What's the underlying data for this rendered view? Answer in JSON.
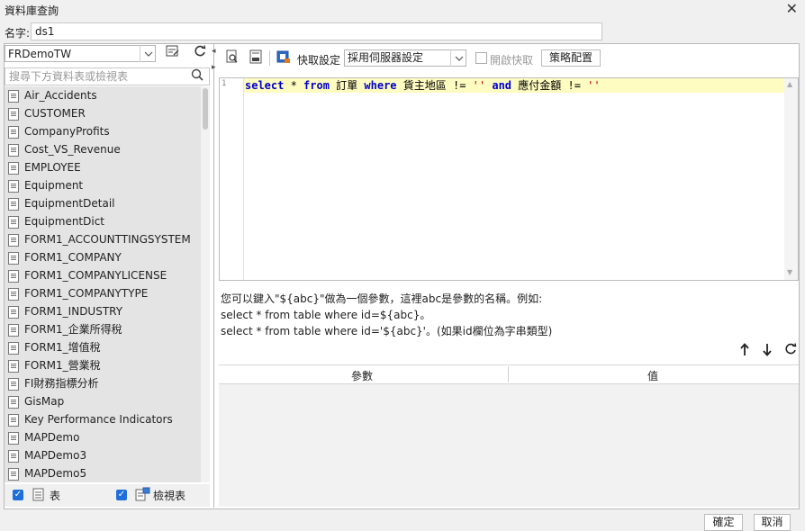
{
  "window": {
    "title": "資料庫查詢"
  },
  "name_field": {
    "label": "名字:",
    "value": "ds1"
  },
  "left_panel": {
    "datasource": "FRDemoTW",
    "search_placeholder": "搜尋下方資料表或檢視表",
    "tables": [
      "Air_Accidents",
      "CUSTOMER",
      "CompanyProfits",
      "Cost_VS_Revenue",
      "EMPLOYEE",
      "Equipment",
      "EquipmentDetail",
      "EquipmentDict",
      "FORM1_ACCOUNTTINGSYSTEM",
      "FORM1_COMPANY",
      "FORM1_COMPANYLICENSE",
      "FORM1_COMPANYTYPE",
      "FORM1_INDUSTRY",
      "FORM1_企業所得稅",
      "FORM1_增值稅",
      "FORM1_營業稅",
      "FI財務指標分析",
      "GisMap",
      "Key Performance Indicators",
      "MAPDemo",
      "MAPDemo3",
      "MAPDemo5"
    ],
    "filter_table_label": "表",
    "filter_view_label": "檢視表"
  },
  "toolbar": {
    "cache_settings_label": "快取設定",
    "cache_mode_value": "採用伺服器設定",
    "enable_cache_label": "開啟快取",
    "strategy_button_label": "策略配置"
  },
  "editor": {
    "line_number": "1",
    "sql": {
      "kw_select": "select",
      "star": " * ",
      "kw_from": "from",
      "table": " 訂單 ",
      "kw_where": "where",
      "cond1": " 貨主地區 != ",
      "str1": "''",
      "space": " ",
      "kw_and": "and",
      "cond2": " 應付金額 != ",
      "str2": "''"
    }
  },
  "hints": {
    "line1": "您可以鍵入\"${abc}\"做為一個參數，這裡abc是參數的名稱。例如:",
    "line2": "select * from table where id=${abc}。",
    "line3": "select * from table where id='${abc}'。(如果id欄位為字串類型)"
  },
  "params_table": {
    "col_param": "參數",
    "col_value": "值"
  },
  "footer": {
    "ok_label": "確定",
    "cancel_label": "取消"
  }
}
